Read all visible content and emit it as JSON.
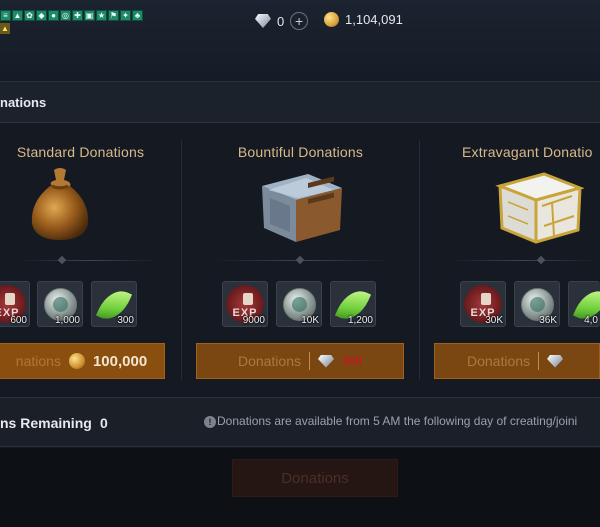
{
  "currency": {
    "diamond_count": "0",
    "gold_count": "1,104,091"
  },
  "panel": {
    "title": "nations"
  },
  "cards": [
    {
      "title": "Standard Donations",
      "rewards": [
        {
          "icon": "exp-icon",
          "qty": "600"
        },
        {
          "icon": "silver-coin-icon",
          "qty": "1,000"
        },
        {
          "icon": "leaf-icon",
          "qty": "300"
        }
      ],
      "button_label": "nations",
      "cost": "100,000",
      "cost_currency": "gold"
    },
    {
      "title": "Bountiful Donations",
      "rewards": [
        {
          "icon": "exp-icon",
          "qty": "9000"
        },
        {
          "icon": "silver-coin-icon",
          "qty": "10K"
        },
        {
          "icon": "leaf-icon",
          "qty": "1,200"
        }
      ],
      "button_label": "Donations",
      "cost": "300",
      "cost_currency": "diamond"
    },
    {
      "title": "Extravagant Donatio",
      "rewards": [
        {
          "icon": "exp-icon",
          "qty": "30K"
        },
        {
          "icon": "silver-coin-icon",
          "qty": "36K"
        },
        {
          "icon": "leaf-icon",
          "qty": "4,0"
        }
      ],
      "button_label": "Donations",
      "cost": "",
      "cost_currency": "diamond"
    }
  ],
  "reward_exp_label": "EXP",
  "footer": {
    "remaining_label": "ns Remaining",
    "remaining_value": "0",
    "notice": "Donations are available from 5 AM the following day of creating/joini"
  },
  "bottom_button": {
    "label": "Donations"
  },
  "colors": {
    "accent_gold_title": "#d9b98a",
    "button_orange": "#7a4712",
    "cost_red": "#c11b1b"
  }
}
